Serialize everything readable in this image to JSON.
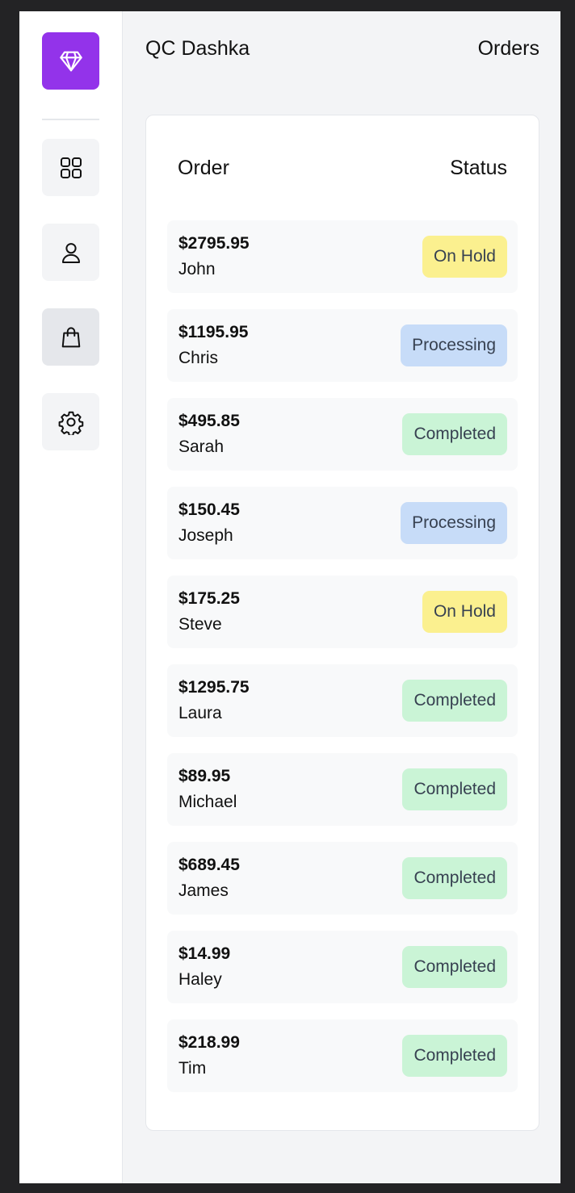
{
  "app": {
    "title": "QC Dashka",
    "page_title": "Orders"
  },
  "sidebar": {
    "logo_icon": "diamond-icon",
    "logo_color": "#9333ea",
    "items": [
      {
        "name": "dashboard",
        "icon": "grid-icon"
      },
      {
        "name": "users",
        "icon": "user-icon"
      },
      {
        "name": "orders",
        "icon": "shopping-bag-icon",
        "active": true
      },
      {
        "name": "settings",
        "icon": "gear-icon"
      }
    ]
  },
  "orders_table": {
    "headers": {
      "order": "Order",
      "status": "Status"
    },
    "rows": [
      {
        "amount": "$2795.95",
        "customer": "John",
        "status": "On Hold",
        "status_type": "hold"
      },
      {
        "amount": "$1195.95",
        "customer": "Chris",
        "status": "Processing",
        "status_type": "processing"
      },
      {
        "amount": "$495.85",
        "customer": "Sarah",
        "status": "Completed",
        "status_type": "completed"
      },
      {
        "amount": "$150.45",
        "customer": "Joseph",
        "status": "Processing",
        "status_type": "processing"
      },
      {
        "amount": "$175.25",
        "customer": "Steve",
        "status": "On Hold",
        "status_type": "hold"
      },
      {
        "amount": "$1295.75",
        "customer": "Laura",
        "status": "Completed",
        "status_type": "completed"
      },
      {
        "amount": "$89.95",
        "customer": "Michael",
        "status": "Completed",
        "status_type": "completed"
      },
      {
        "amount": "$689.45",
        "customer": "James",
        "status": "Completed",
        "status_type": "completed"
      },
      {
        "amount": "$14.99",
        "customer": "Haley",
        "status": "Completed",
        "status_type": "completed"
      },
      {
        "amount": "$218.99",
        "customer": "Tim",
        "status": "Completed",
        "status_type": "completed"
      }
    ]
  },
  "colors": {
    "accent": "#9333ea",
    "on_hold": "#fbf08f",
    "processing": "#c7dcf8",
    "completed": "#caf4d6"
  }
}
